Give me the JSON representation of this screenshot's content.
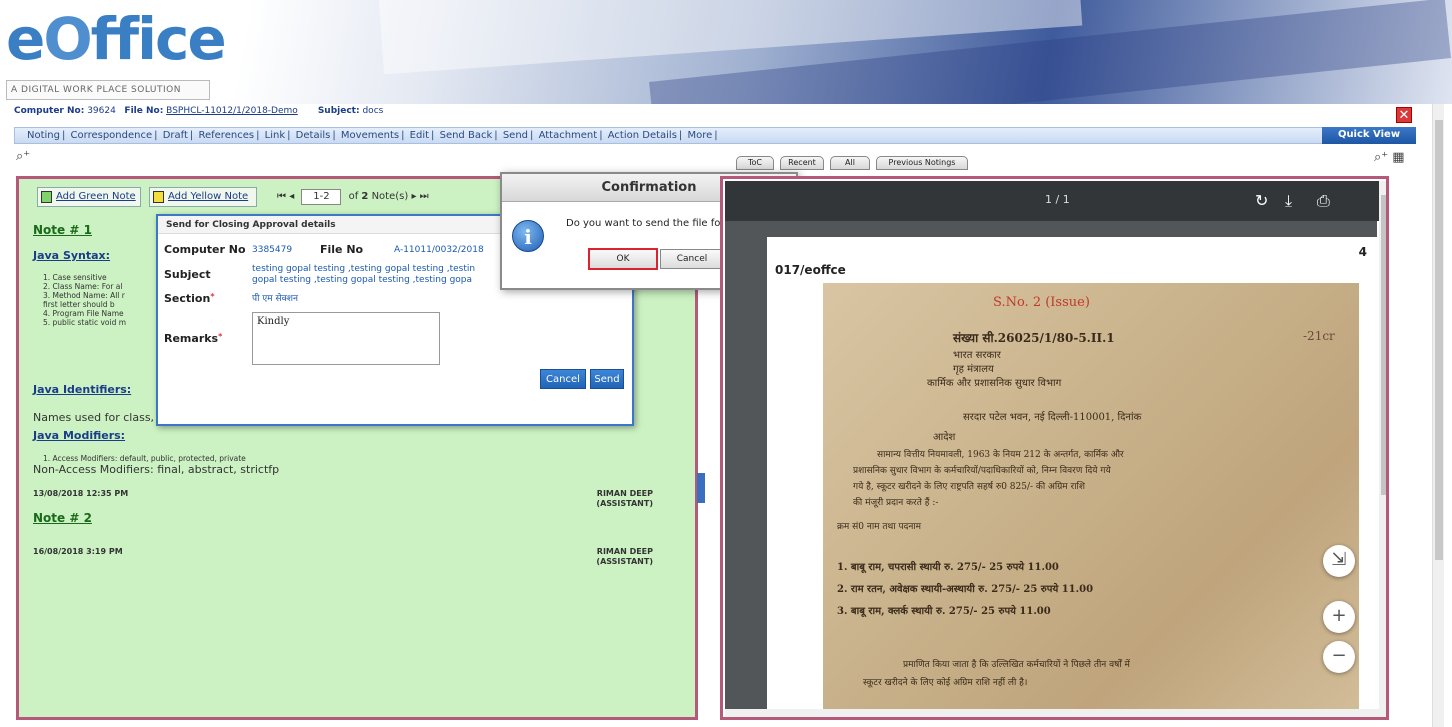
{
  "banner": {
    "logo_prefix": "e",
    "logo_o": "O",
    "logo_rest": "ffice",
    "tagline": "A DIGITAL WORK PLACE SOLUTION"
  },
  "infobar": {
    "computer_no_label": "Computer No:",
    "computer_no": "39624",
    "file_no_label": "File No:",
    "file_no": "BSPHCL-11012/1/2018-Demo",
    "subject_label": "Subject:",
    "subject": "docs"
  },
  "menu": {
    "items": [
      "Noting",
      "Correspondence",
      "Draft",
      "References",
      "Link",
      "Details",
      "Movements",
      "Edit",
      "Send Back",
      "Send",
      "Attachment",
      "Action Details",
      "More"
    ],
    "quick_view": "Quick View"
  },
  "tabs": [
    "ToC",
    "Recent",
    "All",
    "Previous Notings"
  ],
  "notes_toolbar": {
    "add_green": "Add Green Note",
    "add_yellow": "Add Yellow Note",
    "page_range": "1-2",
    "of_label": "of",
    "count": "2",
    "notes_label": "Note(s)"
  },
  "notes": {
    "note1_title": "Note # 1",
    "java_syntax": "Java Syntax:",
    "syntax_lines": [
      "1. Case sensitive",
      "2. Class Name: For al",
      "3. Method Name: All r",
      "first letter should b",
      "4. Program File Name",
      "5. public static void m"
    ],
    "java_identifiers": "Java Identifiers:",
    "identifiers_text": "Names used for class, r",
    "java_modifiers": "Java Modifiers:",
    "modifiers_line1": "1. Access Modifiers: default, public, protected, private",
    "modifiers_line2": "Non-Access Modifiers: final, abstract, strictfp",
    "note1_date": "13/08/2018 12:35 PM",
    "signer_name": "RIMAN DEEP",
    "signer_role": "(ASSISTANT)",
    "note2_title": "Note # 2",
    "note2_date": "16/08/2018 3:19 PM"
  },
  "approval_dialog": {
    "title": "Send for Closing Approval details",
    "computer_no_label": "Computer No",
    "computer_no": "3385479",
    "file_no_label": "File No",
    "file_no": "A-11011/0032/2018",
    "subject_label": "Subject",
    "subject_line1": "testing gopal testing ,testing gopal testing ,testin",
    "subject_line2": "gopal testing ,testing gopal testing ,testing gopa",
    "section_label": "Section",
    "section_value": "पी एम सेक्शन",
    "remarks_label": "Remarks",
    "remarks_value": "Kindly",
    "cancel": "Cancel",
    "send": "Send",
    "required_mark": "*"
  },
  "confirm_dialog": {
    "title": "Confirmation",
    "message": "Do you want to send the file for Approval?",
    "ok": "OK",
    "cancel": "Cancel",
    "icon_glyph": "i"
  },
  "pdf": {
    "page_indicator": "1 / 1",
    "page_number": "4",
    "ref_text": "017/eoffce",
    "scan_lines": [
      "S.No. 2 (Issue)",
      "संख्या सी.26025/1/80-5.II.1",
      "भारत सरकार",
      "गृह मंत्रालय",
      "कार्मिक और प्रशासनिक सुधार विभाग",
      "सरदार पटेल भवन, नई दिल्ली-110001, दिनांक",
      "आदेश",
      "सामान्य वित्तीय नियमावली, 1963 के नियम 212 के अन्तर्गत, कार्मिक और",
      "प्रशासनिक सुधार विभाग के कर्मचारियों/पदाधिकारियों को, निम्न विवरण दिये गये",
      "गये है, स्कूटर खरीदने के लिए राष्ट्रपति सहर्ष रु0 825/- की अग्रिम राशि",
      "की मंजूरी प्रदान करते हैं :-",
      "क्रम सं0 नाम तथा पदनाम",
      "1. बाबू राम, चपरासी   स्थायी  रु. 275/-   25   रुपये 11.00",
      "2. राम रतन, अवेक्षक   स्थायी-अस्थायी  रु. 275/-   25   रुपये 11.00",
      "3. बाबू राम, क्लर्क   स्थायी  रु. 275/-   25   रुपये 11.00",
      "प्रमाणित किया जाता है कि उल्लिखित कर्मचारियों ने पिछले तीन वर्षों में",
      "स्कूटर खरीदने के लिए कोई अग्रिम राशि नहीं ली है।"
    ],
    "margin_note": "-21cr",
    "fab_labels": [
      "⇲",
      "+",
      "−"
    ]
  }
}
